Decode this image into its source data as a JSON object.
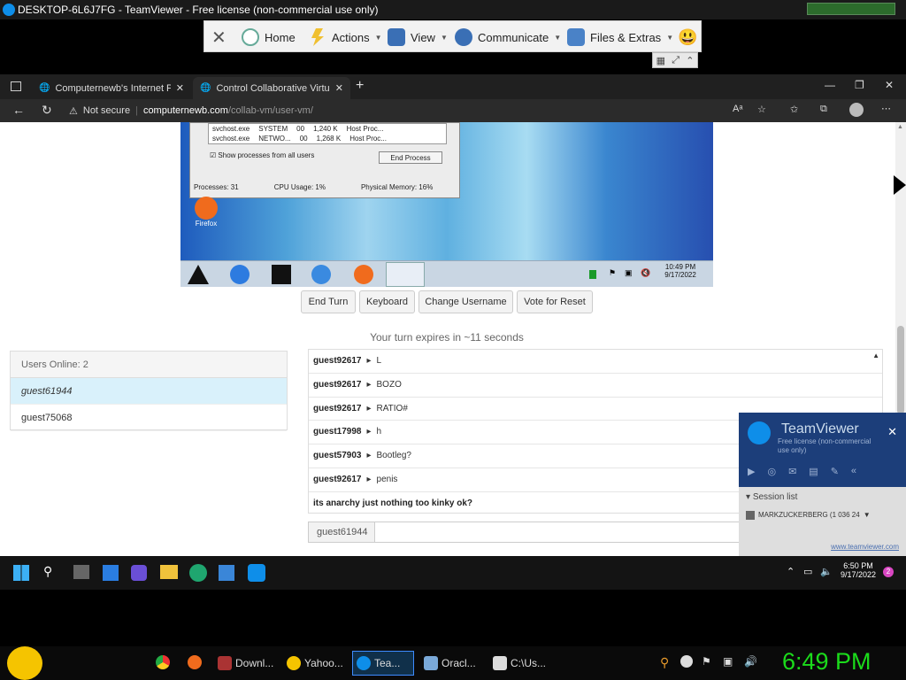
{
  "tv_window": {
    "title": "DESKTOP-6L6J7FG - TeamViewer - Free license (non-commercial use only)"
  },
  "tv_toolbar": {
    "close_symbol": "✕",
    "items": [
      {
        "label": "Home",
        "icon": "home-icon"
      },
      {
        "label": "Actions",
        "icon": "actions-icon"
      },
      {
        "label": "View",
        "icon": "view-icon"
      },
      {
        "label": "Communicate",
        "icon": "communicate-icon"
      },
      {
        "label": "Files & Extras",
        "icon": "files-icon"
      }
    ],
    "emoji": "😃"
  },
  "browser": {
    "tabs": [
      {
        "title": "Computernewb's Internet Pub H"
      },
      {
        "title": "Control Collaborative Virtual Ma"
      }
    ],
    "new_tab": "+",
    "not_secure": "Not secure",
    "url_domain": "computernewb.com",
    "url_path": "/collab-vm/user-vm/"
  },
  "vm": {
    "taskmgr": {
      "rows": [
        [
          "svchost.exe",
          "SYSTEM",
          "00",
          "1,240 K",
          "Host Proc..."
        ],
        [
          "svchost.exe",
          "NETWO...",
          "00",
          "1,268 K",
          "Host Proc..."
        ]
      ],
      "show_all": "Show processes from all users",
      "end_process": "End Process",
      "status": [
        "Processes: 31",
        "CPU Usage: 1%",
        "Physical Memory: 16%"
      ]
    },
    "desktop_icon": "Firefox",
    "clock_time": "10:49 PM",
    "clock_date": "9/17/2022"
  },
  "controls": {
    "end_turn": "End Turn",
    "keyboard": "Keyboard",
    "change_username": "Change Username",
    "vote_reset": "Vote for Reset",
    "turn_text": "Your turn expires in ~11 seconds"
  },
  "users": {
    "header": "Users Online: 2",
    "list": [
      "guest61944",
      "guest75068"
    ]
  },
  "chat": {
    "messages": [
      {
        "user": "guest92617",
        "text": "L"
      },
      {
        "user": "guest92617",
        "text": "BOZO"
      },
      {
        "user": "guest92617",
        "text": "RATIO#"
      },
      {
        "user": "guest17998",
        "text": "h"
      },
      {
        "user": "guest57903",
        "text": "Bootleg?"
      },
      {
        "user": "guest92617",
        "text": "penis"
      },
      {
        "user": "",
        "text": "its anarchy just nothing too kinky ok?"
      }
    ],
    "name": "guest61944"
  },
  "tv_panel": {
    "brand": "TeamViewer",
    "sub": "Free license (non-commercial use only)",
    "session_list": "Session list",
    "session": "MARKZUCKERBERG (1 036 24",
    "link": "www.teamviewer.com"
  },
  "remote_taskbar": {
    "time": "6:50 PM",
    "date": "9/17/2022",
    "badge": "2"
  },
  "local_taskbar": {
    "items": [
      {
        "label": "Downl...",
        "icon": "download-icon"
      },
      {
        "label": "Yahoo...",
        "icon": "yahoo-icon"
      },
      {
        "label": "Tea...",
        "icon": "teamviewer-icon"
      },
      {
        "label": "Oracl...",
        "icon": "virtualbox-icon"
      },
      {
        "label": "C:\\Us...",
        "icon": "7zip-icon"
      }
    ],
    "clock": "6:49 PM"
  }
}
